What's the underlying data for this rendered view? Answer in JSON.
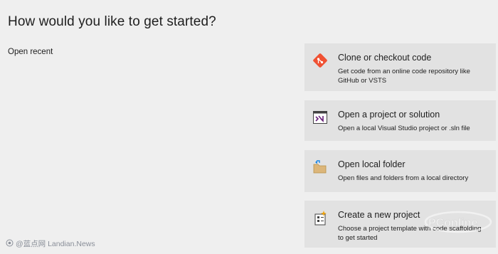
{
  "page": {
    "title": "How would you like to get started?",
    "open_recent_label": "Open recent"
  },
  "actions": [
    {
      "title": "Clone or checkout code",
      "description": "Get code from an online code repository like GitHub or VSTS",
      "icon": "git-clone-icon",
      "icon_color": "#f05133"
    },
    {
      "title": "Open a project or solution",
      "description": "Open a local Visual Studio project or .sln file",
      "icon": "visual-studio-solution-icon",
      "icon_color": "#68217a"
    },
    {
      "title": "Open local folder",
      "description": "Open files and folders from a local directory",
      "icon": "folder-icon",
      "icon_color": "#dcb67a"
    },
    {
      "title": "Create a new project",
      "description": "Choose a project template with code scaffolding to get started",
      "icon": "new-project-icon",
      "icon_color": "#f0a30a"
    }
  ],
  "watermark": {
    "left_text": "@蓝点网 Landian.News",
    "right_text": "PConline"
  }
}
